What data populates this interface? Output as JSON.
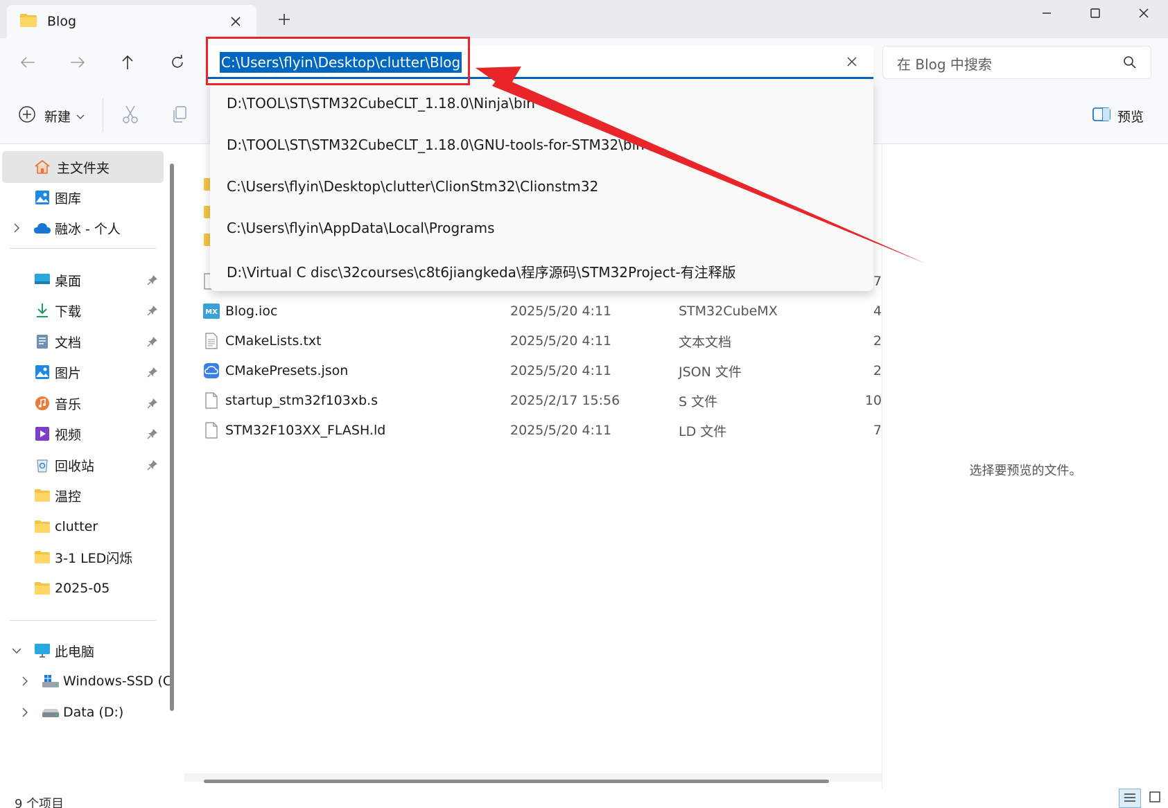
{
  "tab": {
    "title": "Blog"
  },
  "address": {
    "path": "C:\\Users\\flyin\\Desktop\\clutter\\Blog",
    "suggestions": [
      "D:\\TOOL\\ST\\STM32CubeCLT_1.18.0\\Ninja\\bin",
      "D:\\TOOL\\ST\\STM32CubeCLT_1.18.0\\GNU-tools-for-STM32\\bin",
      "C:\\Users\\flyin\\Desktop\\clutter\\ClionStm32\\Clionstm32",
      "C:\\Users\\flyin\\AppData\\Local\\Programs",
      "D:\\Virtual C disc\\32courses\\c8t6jiangkeda\\程序源码\\STM32Project-有注释版"
    ]
  },
  "search": {
    "placeholder": "在 Blog 中搜索"
  },
  "toolbar": {
    "new_label": "新建",
    "preview_label": "预览"
  },
  "sidebar": {
    "home": "主文件夹",
    "gallery": "图库",
    "onedrive": "融冰 - 个人",
    "pinned": [
      {
        "label": "桌面",
        "icon": "desktop-icon"
      },
      {
        "label": "下载",
        "icon": "download-icon"
      },
      {
        "label": "文档",
        "icon": "document-icon"
      },
      {
        "label": "图片",
        "icon": "pictures-icon"
      },
      {
        "label": "音乐",
        "icon": "music-icon"
      },
      {
        "label": "视频",
        "icon": "video-icon"
      },
      {
        "label": "回收站",
        "icon": "recycle-bin-icon"
      },
      {
        "label": "温控",
        "icon": "folder-icon"
      },
      {
        "label": "clutter",
        "icon": "folder-icon"
      },
      {
        "label": "3-1 LED闪烁",
        "icon": "folder-icon"
      },
      {
        "label": "2025-05",
        "icon": "folder-icon"
      }
    ],
    "this_pc": "此电脑",
    "drives": [
      {
        "label": "Windows-SSD (C",
        "icon": "windows-drive-icon"
      },
      {
        "label": "Data (D:)",
        "icon": "drive-icon"
      }
    ]
  },
  "files": [
    {
      "name": "Blog.ioc",
      "date": "2025/5/20 4:11",
      "type": "STM32CubeMX",
      "size": "4",
      "icon": "mx-icon"
    },
    {
      "name": "CMakeLists.txt",
      "date": "2025/5/20 4:11",
      "type": "文本文档",
      "size": "2",
      "icon": "text-file-icon"
    },
    {
      "name": "CMakePresets.json",
      "date": "2025/5/20 4:11",
      "type": "JSON 文件",
      "size": "2",
      "icon": "json-file-icon"
    },
    {
      "name": "startup_stm32f103xb.s",
      "date": "2025/2/17 15:56",
      "type": "S 文件",
      "size": "10",
      "icon": "file-icon"
    },
    {
      "name": "STM32F103XX_FLASH.ld",
      "date": "2025/5/20 4:11",
      "type": "LD 文件",
      "size": "7",
      "icon": "file-icon"
    }
  ],
  "hidden_row_size": "7",
  "preview": {
    "empty_text": "选择要预览的文件。"
  },
  "status": {
    "item_count": "9 个项目"
  },
  "colors": {
    "accent": "#0067c0",
    "annotation_red": "#e8262a",
    "folder": "#f5c443"
  }
}
